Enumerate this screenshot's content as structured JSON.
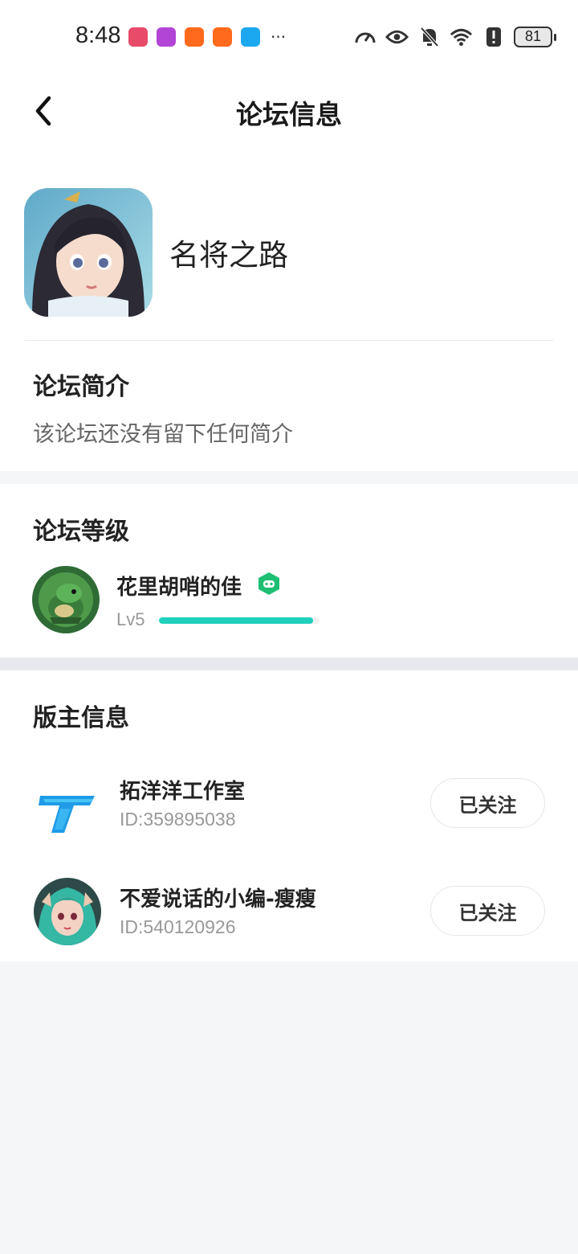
{
  "status_bar": {
    "time": "8:48",
    "more": "···",
    "battery": "81"
  },
  "header": {
    "title": "论坛信息"
  },
  "forum": {
    "name": "名将之路",
    "intro_title": "论坛简介",
    "intro_text": "该论坛还没有留下任何简介"
  },
  "level": {
    "section_title": "论坛等级",
    "user_name": "花里胡哨的佳",
    "level_label": "Lv5",
    "progress_fraction": 0.96,
    "accent_color": "#1fd0bd"
  },
  "moderators": {
    "section_title": "版主信息",
    "items": [
      {
        "name": "拓洋洋工作室",
        "id": "ID:359895038",
        "follow_label": "已关注"
      },
      {
        "name": "不爱说话的小编-瘦瘦",
        "id": "ID:540120926",
        "follow_label": "已关注"
      }
    ]
  }
}
